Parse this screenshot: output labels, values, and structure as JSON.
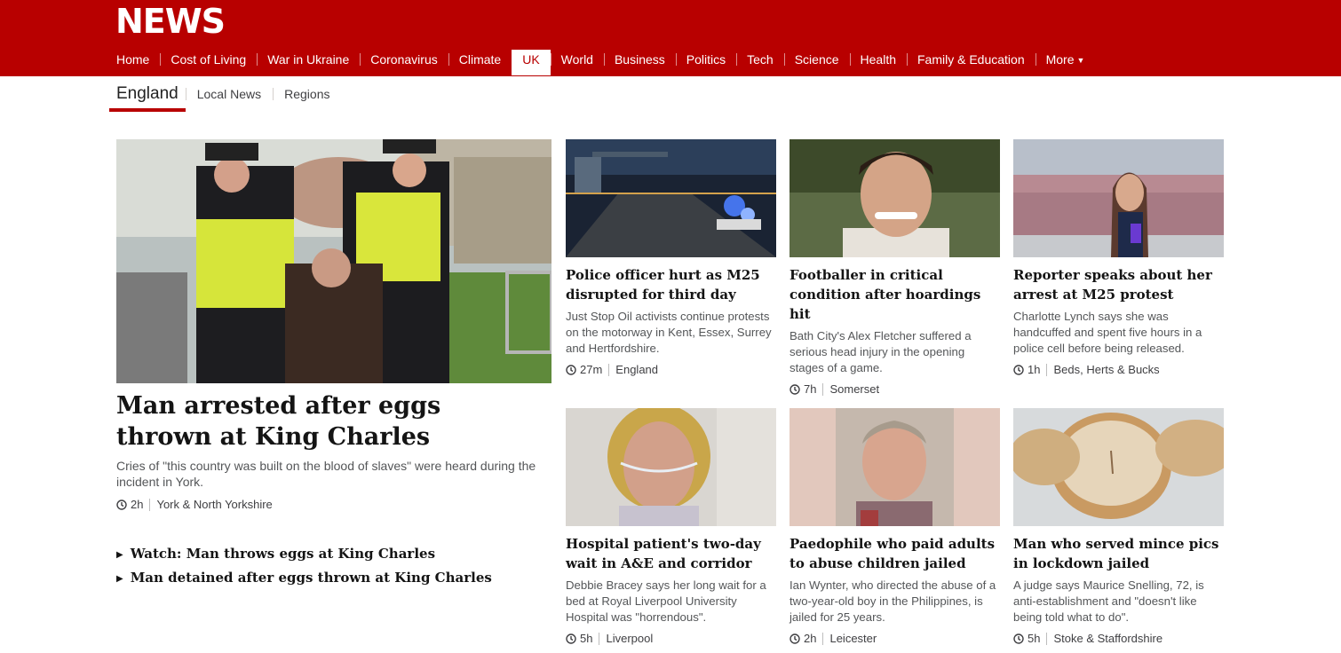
{
  "brand": {
    "logo": "NEWS"
  },
  "nav": {
    "items": [
      {
        "label": "Home"
      },
      {
        "label": "Cost of Living"
      },
      {
        "label": "War in Ukraine"
      },
      {
        "label": "Coronavirus"
      },
      {
        "label": "Climate"
      },
      {
        "label": "UK",
        "active": true
      },
      {
        "label": "World"
      },
      {
        "label": "Business"
      },
      {
        "label": "Politics"
      },
      {
        "label": "Tech"
      },
      {
        "label": "Science"
      },
      {
        "label": "Health"
      },
      {
        "label": "Family & Education"
      }
    ],
    "more": "More"
  },
  "subnav": {
    "items": [
      {
        "label": "England",
        "active": true
      },
      {
        "label": "Local News"
      },
      {
        "label": "Regions"
      }
    ]
  },
  "lead": {
    "title": "Man arrested after eggs thrown at King Charles",
    "summary": "Cries of \"this country was built on the blood of slaves\" were heard during the incident in York.",
    "time": "2h",
    "region": "York & North Yorkshire",
    "related": [
      "Watch: Man throws eggs at King Charles",
      "Man detained after eggs thrown at King Charles"
    ]
  },
  "cards": [
    {
      "title": "Police officer hurt as M25 disrupted for third day",
      "summary": "Just Stop Oil activists continue protests on the motorway in Kent, Essex, Surrey and Hertfordshire.",
      "time": "27m",
      "region": "England"
    },
    {
      "title": "Footballer in critical condition after hoardings hit",
      "summary": "Bath City's Alex Fletcher suffered a serious head injury in the opening stages of a game.",
      "time": "7h",
      "region": "Somerset"
    },
    {
      "title": "Reporter speaks about her arrest at M25 protest",
      "summary": "Charlotte Lynch says she was handcuffed and spent five hours in a police cell before being released.",
      "time": "1h",
      "region": "Beds, Herts & Bucks"
    },
    {
      "title": "Hospital patient's two-day wait in A&E and corridor",
      "summary": "Debbie Bracey says her long wait for a bed at Royal Liverpool University Hospital was \"horrendous\".",
      "time": "5h",
      "region": "Liverpool"
    },
    {
      "title": "Paedophile who paid adults to abuse children jailed",
      "summary": "Ian Wynter, who directed the abuse of a two-year-old boy in the Philippines, is jailed for 25 years.",
      "time": "2h",
      "region": "Leicester"
    },
    {
      "title": "Man who served mince pics in lockdown jailed",
      "summary": "A judge says Maurice Snelling, 72, is anti-establishment and \"doesn't like being told what to do\".",
      "time": "5h",
      "region": "Stoke & Staffordshire"
    }
  ],
  "colors": {
    "brand_red": "#b80000",
    "text": "#141414",
    "muted": "#545658"
  }
}
